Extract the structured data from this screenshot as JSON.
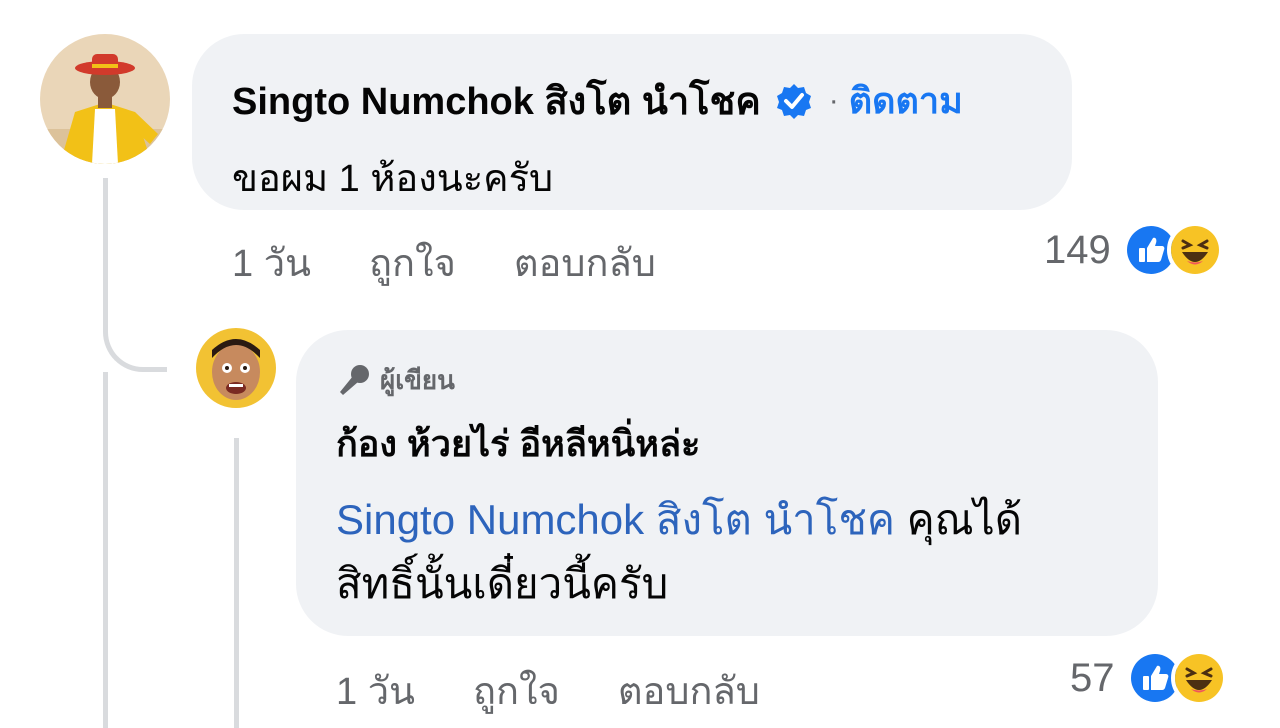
{
  "comment": {
    "author": "Singto Numchok สิงโต นำโชค",
    "separator": "·",
    "follow_label": "ติดตาม",
    "text": "ขอผม 1 ห้องนะครับ",
    "time": "1 วัน",
    "like_label": "ถูกใจ",
    "reply_label": "ตอบกลับ",
    "reaction_count": "149",
    "reaction_icons": [
      "like-icon",
      "haha-icon"
    ]
  },
  "reply": {
    "author_badge": "ผู้เขียน",
    "author": "ก้อง ห้วยไร่ อีหลีหนิ่หล่ะ",
    "mention": "Singto Numchok สิงโต นำโชค",
    "text_after_mention": " คุณได้",
    "text_line2": "สิทธิ์นั้นเดี๋ยวนี้ครับ",
    "time": "1 วัน",
    "like_label": "ถูกใจ",
    "reply_label": "ตอบกลับ",
    "reaction_count": "57",
    "reaction_icons": [
      "like-icon",
      "haha-icon"
    ]
  },
  "colors": {
    "bubble": "#f0f2f5",
    "link": "#1877f2",
    "secondary_text": "#65676b",
    "thread_line": "#d9dbde"
  }
}
